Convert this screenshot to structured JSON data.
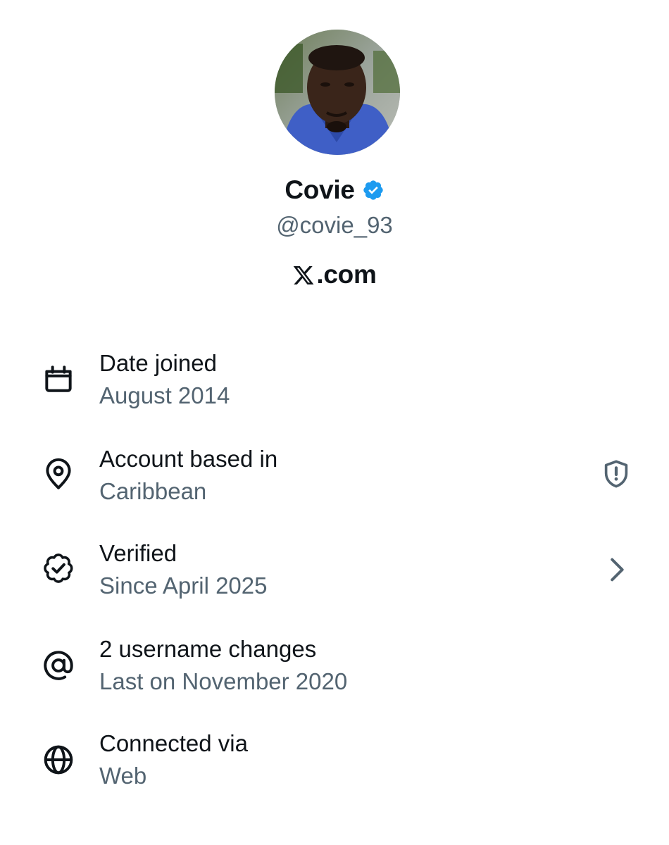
{
  "profile": {
    "display_name": "Covie",
    "handle": "@covie_93",
    "brand": ".com",
    "verified_color": "#1d9bf0",
    "avatar_icon": "profile-photo"
  },
  "rows": [
    {
      "icon": "calendar-icon",
      "title": "Date joined",
      "subtitle": "August 2014"
    },
    {
      "icon": "location-pin-icon",
      "title": "Account based in",
      "subtitle": "Caribbean",
      "trailing_icon": "shield-alert-icon"
    },
    {
      "icon": "verified-badge-icon",
      "title": "Verified",
      "subtitle": "Since April 2025",
      "trailing_icon": "chevron-right-icon"
    },
    {
      "icon": "at-sign-icon",
      "title": "2 username changes",
      "subtitle": "Last on November 2020"
    },
    {
      "icon": "globe-icon",
      "title": "Connected via",
      "subtitle": "Web"
    }
  ],
  "colors": {
    "text_primary": "#0f1419",
    "text_secondary": "#536471",
    "background": "#ffffff",
    "accent": "#1d9bf0"
  }
}
